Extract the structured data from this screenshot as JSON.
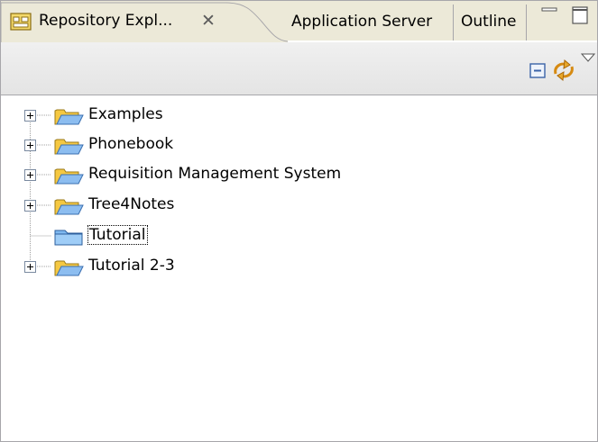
{
  "tabs": {
    "repository_label": "Repository Expl...",
    "repository_close": "✕",
    "application_label": "Application Server",
    "outline_label": "Outline"
  },
  "tree": {
    "items": [
      {
        "label": "Examples",
        "expandable": true,
        "selected": false
      },
      {
        "label": "Phonebook",
        "expandable": true,
        "selected": false
      },
      {
        "label": "Requisition Management System",
        "expandable": true,
        "selected": false
      },
      {
        "label": "Tree4Notes",
        "expandable": true,
        "selected": false
      },
      {
        "label": "Tutorial",
        "expandable": false,
        "selected": true
      },
      {
        "label": "Tutorial 2-3",
        "expandable": true,
        "selected": false
      }
    ]
  },
  "colors": {
    "chrome": "#ece9d8",
    "border": "#a7a6aa",
    "folder": "#f7d24d",
    "selected_folder": "#7fb8f0"
  }
}
